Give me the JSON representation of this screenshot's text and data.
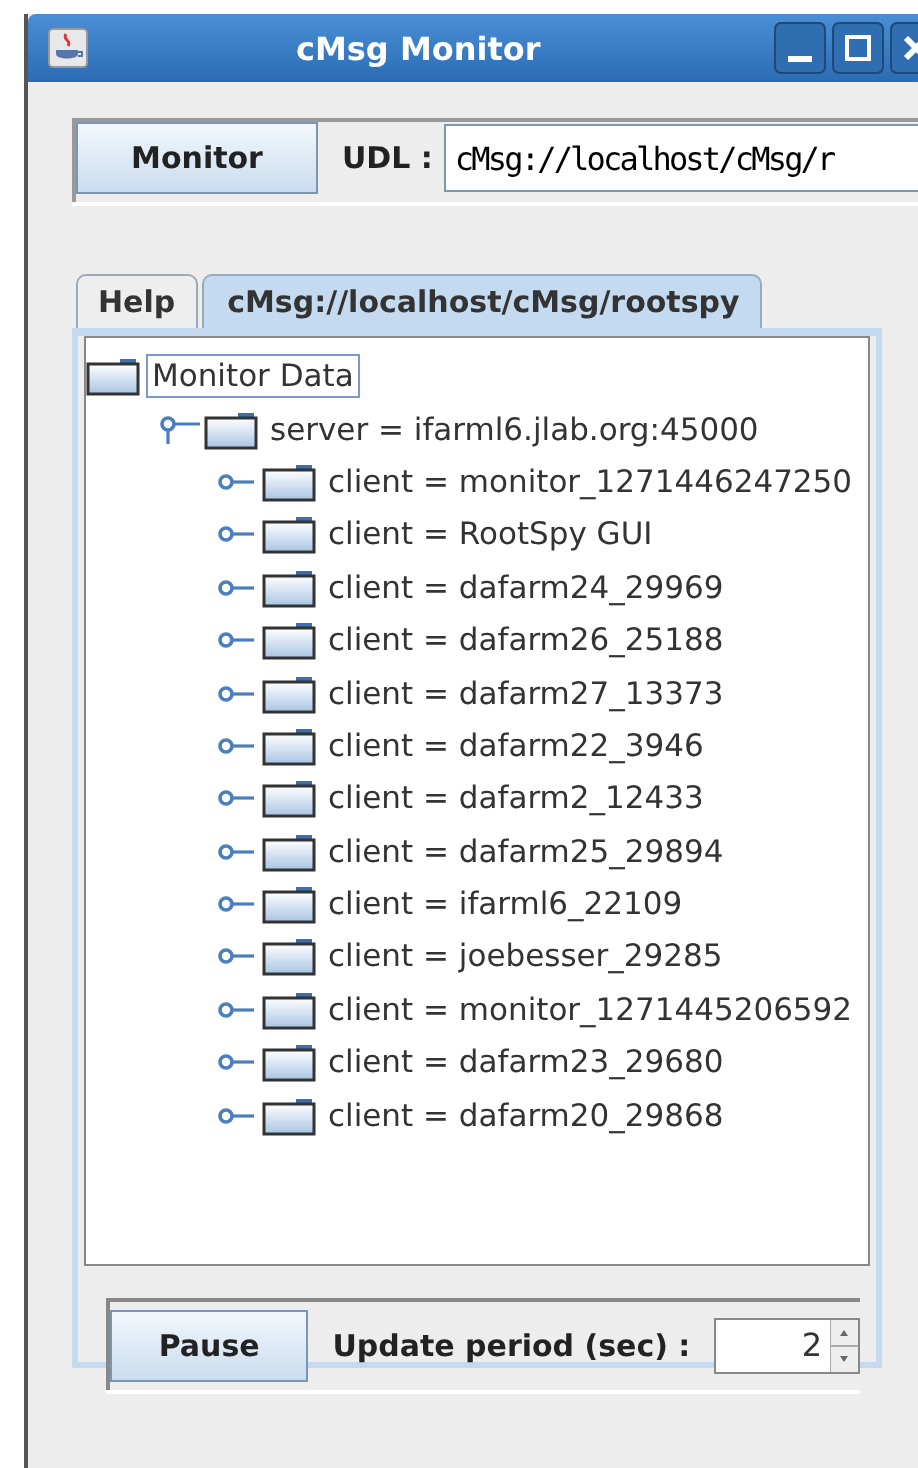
{
  "window": {
    "title": "cMsg Monitor"
  },
  "connection": {
    "button": "Monitor",
    "udl_label": "UDL :",
    "udl_value": "cMsg://localhost/cMsg/r"
  },
  "tabs": [
    {
      "label": "Help",
      "selected": false
    },
    {
      "label": "cMsg://localhost/cMsg/rootspy",
      "selected": true
    }
  ],
  "tree": {
    "label": "Monitor Data",
    "selected": true,
    "children": [
      {
        "label": "server = ifarml6.jlab.org:45000",
        "expanded": true,
        "selected": false,
        "children": [
          {
            "label": "client = monitor_1271446247250",
            "expanded": false,
            "selected": false
          },
          {
            "label": "client = RootSpy GUI",
            "expanded": false,
            "selected": false
          },
          {
            "label": "client = dafarm24_29969",
            "expanded": false,
            "selected": false
          },
          {
            "label": "client = dafarm26_25188",
            "expanded": false,
            "selected": false
          },
          {
            "label": "client = dafarm27_13373",
            "expanded": false,
            "selected": false
          },
          {
            "label": "client = dafarm22_3946",
            "expanded": false,
            "selected": false
          },
          {
            "label": "client = dafarm2_12433",
            "expanded": false,
            "selected": false
          },
          {
            "label": "client = dafarm25_29894",
            "expanded": false,
            "selected": false
          },
          {
            "label": "client = ifarml6_22109",
            "expanded": false,
            "selected": false
          },
          {
            "label": "client = joebesser_29285",
            "expanded": false,
            "selected": false
          },
          {
            "label": "client = monitor_1271445206592",
            "expanded": false,
            "selected": false
          },
          {
            "label": "client = dafarm23_29680",
            "expanded": false,
            "selected": false
          },
          {
            "label": "client = dafarm20_29868",
            "expanded": false,
            "selected": false
          }
        ]
      }
    ]
  },
  "controls": {
    "button": "Pause",
    "period_label": "Update period (sec) :",
    "period_value": "2"
  }
}
